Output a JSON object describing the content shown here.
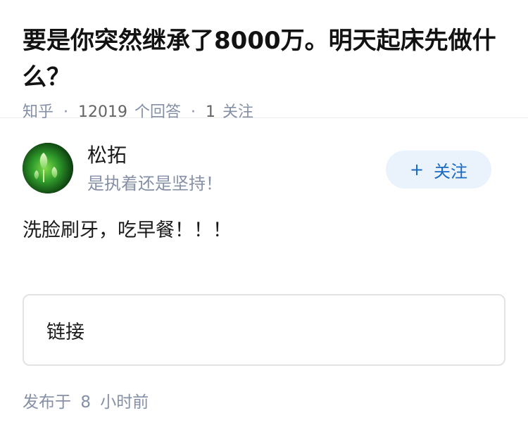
{
  "question": {
    "title": "要是你突然继承了8000万。明天起床先做什么？",
    "source": "知乎",
    "answer_count": "12019",
    "answer_label": "个回答",
    "follow_count": "1",
    "follow_label": "关注"
  },
  "author": {
    "name": "松拓",
    "bio": "是执着还是坚持！",
    "follow_button": "关注",
    "follow_icon": "plus-icon"
  },
  "answer": {
    "content": "洗脸刷牙，吃早餐！！！",
    "link_card_label": "链接"
  },
  "footer": {
    "posted_label": "发布于",
    "posted_num": "8",
    "posted_suffix": "小时前"
  }
}
